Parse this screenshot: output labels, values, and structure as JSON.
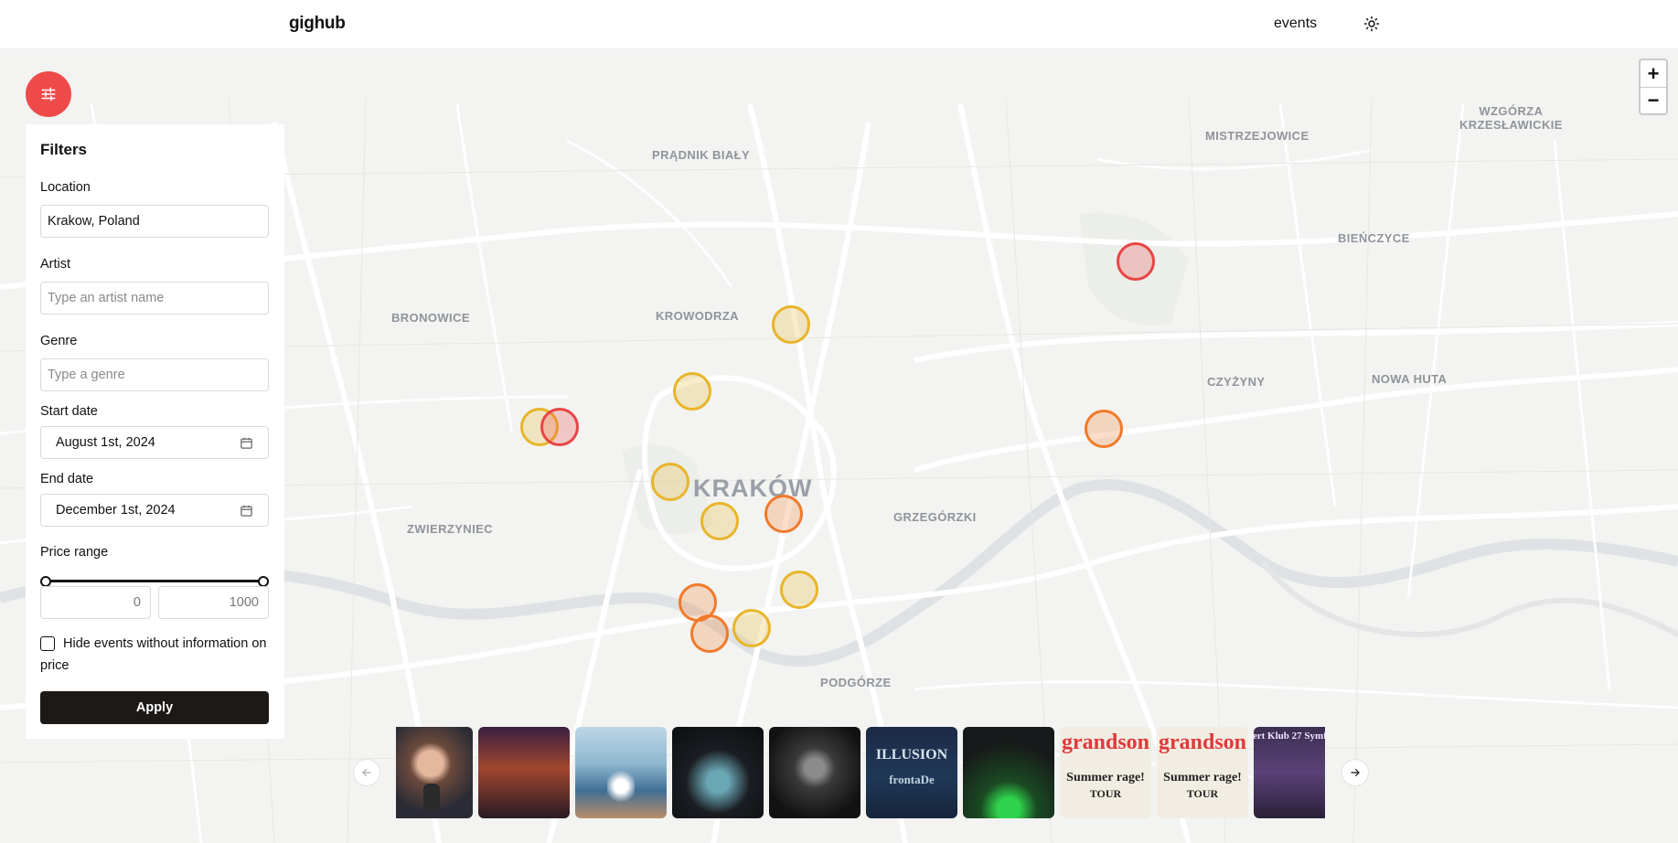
{
  "header": {
    "brand": "gighub",
    "nav_events": "events",
    "theme_icon": "sun-icon"
  },
  "map": {
    "places": {
      "pradnik_bialy": "PRĄDNIK BIAŁY",
      "mistrzejowice": "MISTRZEJOWICE",
      "wzgorza_line1": "WZGÓRZA",
      "wzgorza_line2": "KRZESŁAWICKIE",
      "bienczyce": "BIEŃCZYCE",
      "bronowice": "BRONOWICE",
      "krowodrza": "KROWODRZA",
      "czyzyny": "CZYŻYNY",
      "nowa_huta": "NOWA HUTA",
      "krakow": "KRAKÓW",
      "grzegorzki": "GRZEGÓRZKI",
      "zwierzyniec": "ZWIERZYNIEC",
      "podgorze": "PODGÓRZE"
    },
    "zoom_in": "+",
    "zoom_out": "−",
    "marker_colors": {
      "yellow": "#e8b52a",
      "orange": "#f07a2a",
      "red": "#e84545"
    }
  },
  "filters": {
    "toggle_icon": "sliders-icon",
    "title": "Filters",
    "location_label": "Location",
    "location_value": "Krakow, Poland",
    "artist_label": "Artist",
    "artist_placeholder": "Type an artist name",
    "genre_label": "Genre",
    "genre_placeholder": "Type a genre",
    "start_label": "Start date",
    "start_value": "August 1st, 2024",
    "end_label": "End date",
    "end_value": "December 1st, 2024",
    "price_label": "Price range",
    "price_min": "0",
    "price_max": "1000",
    "hide_label": "Hide events without information on price",
    "hide_checked": false,
    "apply_label": "Apply"
  },
  "carousel": {
    "prev_icon": "arrow-left-icon",
    "next_icon": "arrow-right-icon",
    "thumbs": {
      "t5_text": "ILLUSION",
      "t5_sub": "frontaDe",
      "t8_text": "grandson",
      "t8_sub1": "Summer rage!",
      "t8_sub2": "TOUR",
      "t9_text": "grandson",
      "t9_sub1": "Summer rage!",
      "t9_sub2": "TOUR",
      "t10_text": "cert Klub 27 Symf"
    }
  },
  "accent": "#ef4a4a"
}
